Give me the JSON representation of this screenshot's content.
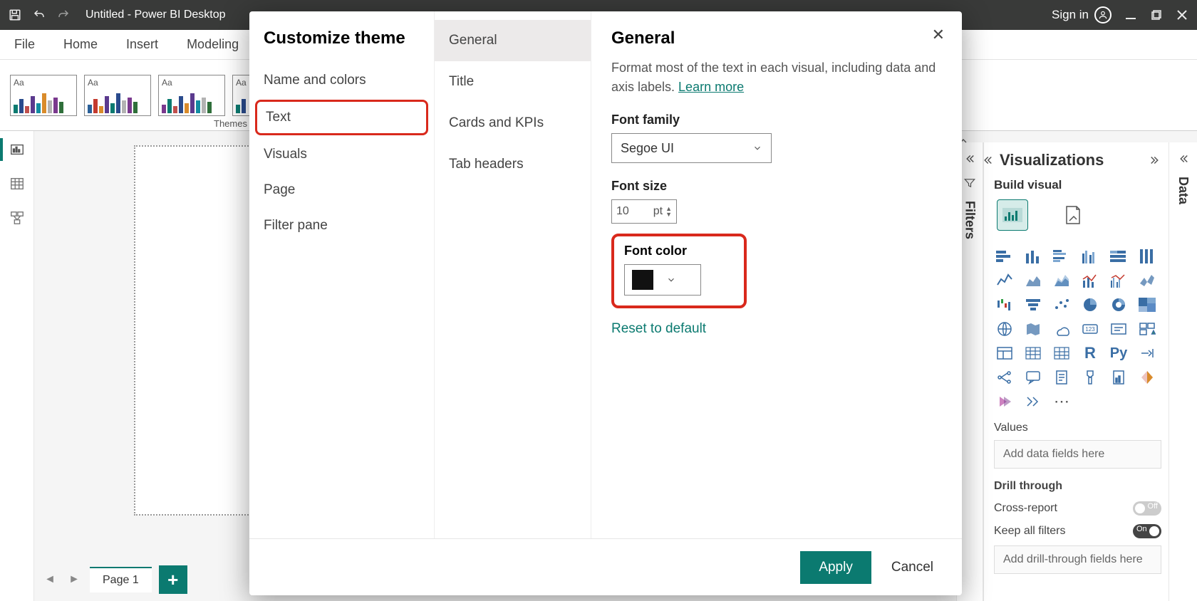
{
  "titlebar": {
    "title": "Untitled - Power BI Desktop",
    "signin": "Sign in"
  },
  "ribbon": {
    "tabs": [
      "File",
      "Home",
      "Insert",
      "Modeling"
    ],
    "themes_label": "Themes"
  },
  "left_tools": {
    "report": "Report view",
    "data": "Data view",
    "model": "Model view"
  },
  "page_tabs": {
    "page1": "Page 1"
  },
  "panes": {
    "filters": "Filters",
    "visualizations": "Visualizations",
    "build_visual": "Build visual",
    "data": "Data",
    "values": "Values",
    "values_placeholder": "Add data fields here",
    "drill_through": "Drill through",
    "cross_report": "Cross-report",
    "keep_all_filters": "Keep all filters",
    "drill_placeholder": "Add drill-through fields here",
    "off": "Off",
    "on": "On"
  },
  "dialog": {
    "title": "Customize theme",
    "nav": {
      "name_colors": "Name and colors",
      "text": "Text",
      "visuals": "Visuals",
      "page": "Page",
      "filter_pane": "Filter pane"
    },
    "subnav": {
      "general": "General",
      "title": "Title",
      "cards_kpis": "Cards and KPIs",
      "tab_headers": "Tab headers"
    },
    "panel": {
      "heading": "General",
      "desc_a": "Format most of the text in each visual, including data and axis labels. ",
      "learn_more": "Learn more",
      "font_family_label": "Font family",
      "font_family_value": "Segoe UI",
      "font_size_label": "Font size",
      "font_size_value": "10",
      "font_size_unit": "pt",
      "font_color_label": "Font color",
      "reset": "Reset to default"
    },
    "buttons": {
      "apply": "Apply",
      "cancel": "Cancel"
    }
  }
}
